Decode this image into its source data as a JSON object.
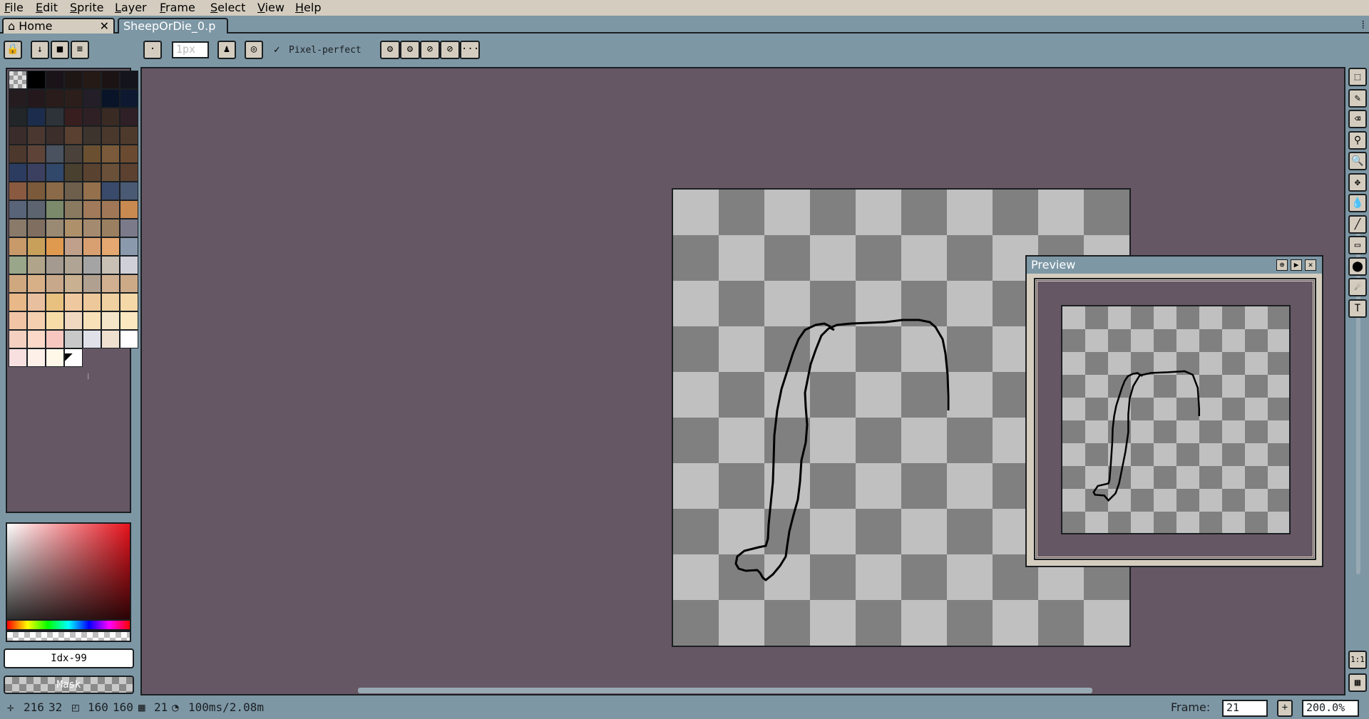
{
  "menu": {
    "items": [
      {
        "pre": "",
        "ul": "F",
        "post": "ile"
      },
      {
        "pre": "",
        "ul": "E",
        "post": "dit"
      },
      {
        "pre": "",
        "ul": "S",
        "post": "prite"
      },
      {
        "pre": "",
        "ul": "L",
        "post": "ayer"
      },
      {
        "pre": "",
        "ul": "F",
        "post": "rame"
      },
      {
        "pre": "",
        "ul": "S",
        "post": "elect"
      },
      {
        "pre": "",
        "ul": "V",
        "post": "iew"
      },
      {
        "pre": "",
        "ul": "H",
        "post": "elp"
      }
    ]
  },
  "tabs": {
    "home_label": "Home",
    "home_close": "✕",
    "file_label": "SheepOrDie_0.p",
    "file_modified": "●",
    "overflow": "⁞"
  },
  "toolbar": {
    "lock_icon": "🔒",
    "dot": "·",
    "brush_size": "1px",
    "pixel_perfect_check": "✓",
    "pixel_perfect_label": "Pixel-perfect",
    "more": "···"
  },
  "palette": {
    "colors": [
      "#202020",
      "#000000",
      "#1a1418",
      "#1e1614",
      "#261a16",
      "#1c1414",
      "#14141c",
      "#251c20",
      "#24181c",
      "#2a1c1a",
      "#2c1e1a",
      "#231e28",
      "#0a1428",
      "#0e1830",
      "#232629",
      "#1c2c4c",
      "#2d3338",
      "#381e1e",
      "#2e2024",
      "#3a2a24",
      "#2e2026",
      "#3a2c2a",
      "#4a3830",
      "#3c2e2a",
      "#5a4030",
      "#3e342e",
      "#4a382c",
      "#4e3a2c",
      "#4c382c",
      "#5e4438",
      "#4a5260",
      "#4a423a",
      "#6a5030",
      "#7a5a3a",
      "#6a4a30",
      "#2c3c60",
      "#3c4060",
      "#32486a",
      "#4a4030",
      "#5a4230",
      "#6a5038",
      "#5c4030",
      "#8a5a40",
      "#7a5a3a",
      "#8a6a48",
      "#6e5e4c",
      "#94704c",
      "#3a4a6a",
      "#4a5a74",
      "#5a6478",
      "#5c6470",
      "#7a8a6a",
      "#8a7a60",
      "#a07a5a",
      "#a07858",
      "#c88a50",
      "#8a7a6a",
      "#806e60",
      "#9a8a74",
      "#ae906a",
      "#a48a6e",
      "#9a8060",
      "#7a7a8a",
      "#c89a6a",
      "#c8a05a",
      "#e09a50",
      "#c0a08a",
      "#d8a070",
      "#e4a870",
      "#8a9aac",
      "#9aa68a",
      "#b0a48a",
      "#a49a90",
      "#b0a494",
      "#a4a4a4",
      "#c8c0b4",
      "#d0d0d8",
      "#d0a880",
      "#d8b088",
      "#c8a88a",
      "#c8b090",
      "#b0a090",
      "#d0b090",
      "#ccaa88",
      "#e8b888",
      "#e8c0a0",
      "#e8c080",
      "#f0c8a0",
      "#ecc89a",
      "#f0d0a0",
      "#f4d8a8",
      "#f0c4a4",
      "#f4d0b0",
      "#f8dca8",
      "#f0d8c0",
      "#f8e0b8",
      "#f4e4c8",
      "#fce8c0",
      "#f4d0c0",
      "#fcd8c8",
      "#f8c8c0",
      "#c8c8c8",
      "#e0e0e8",
      "#f0e0d0",
      "#ffffff",
      "#f8e0e0",
      "#fcf0e8",
      "#fff8e8",
      "#ffffff"
    ],
    "selected_glyph": "◤",
    "grip": "⁞"
  },
  "color_index": "Idx-99",
  "mask_label": "Mask",
  "preview": {
    "title": "Preview",
    "pin": "⊕",
    "play": "▶",
    "close": "✕"
  },
  "status": {
    "pos_x": "216",
    "pos_y": "32",
    "size_w": "160",
    "size_h": "160",
    "frame_icon_value": "21",
    "duration": "100ms/2.08m",
    "frame_label": "Frame:",
    "frame_value": "21",
    "add_frame": "+",
    "zoom": "200.0%"
  },
  "right_tools": [
    {
      "name": "marquee-icon",
      "glyph": "⬚"
    },
    {
      "name": "pencil-icon",
      "glyph": "✎"
    },
    {
      "name": "eraser-icon",
      "glyph": "⌫"
    },
    {
      "name": "eyedropper-icon",
      "glyph": "⚲"
    },
    {
      "name": "zoom-icon",
      "glyph": "🔍"
    },
    {
      "name": "move-icon",
      "glyph": "✥"
    },
    {
      "name": "fill-icon",
      "glyph": "💧"
    },
    {
      "name": "line-icon",
      "glyph": "╱"
    },
    {
      "name": "rectangle-icon",
      "glyph": "▭"
    },
    {
      "name": "ellipse-icon",
      "glyph": "⬤"
    },
    {
      "name": "spray-icon",
      "glyph": "☄"
    },
    {
      "name": "text-icon",
      "glyph": "T"
    }
  ],
  "bottom_tools": {
    "one_to_one": "1:1",
    "timeline": "▦"
  }
}
